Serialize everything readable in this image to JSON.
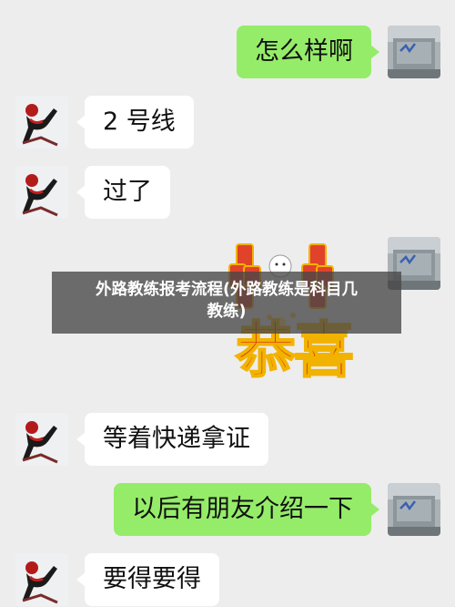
{
  "messages": [
    {
      "side": "self",
      "text": "怎么样啊"
    },
    {
      "side": "other",
      "text": "2 号线"
    },
    {
      "side": "other",
      "text": "过了"
    },
    {
      "side": "self",
      "sticker": "恭喜"
    },
    {
      "side": "other",
      "text": "等着快递拿证"
    },
    {
      "side": "self",
      "text": "以后有朋友介绍一下"
    },
    {
      "side": "other",
      "text": "要得要得"
    }
  ],
  "sticker": {
    "text": "恭喜"
  },
  "banner": {
    "line1": "外路教练报考流程(外路教练是科目几",
    "line2": "教练)"
  },
  "colors": {
    "background": "#ededed",
    "self_bubble": "#95ec69",
    "other_bubble": "#ffffff",
    "sticker_text": "#d42a12"
  }
}
